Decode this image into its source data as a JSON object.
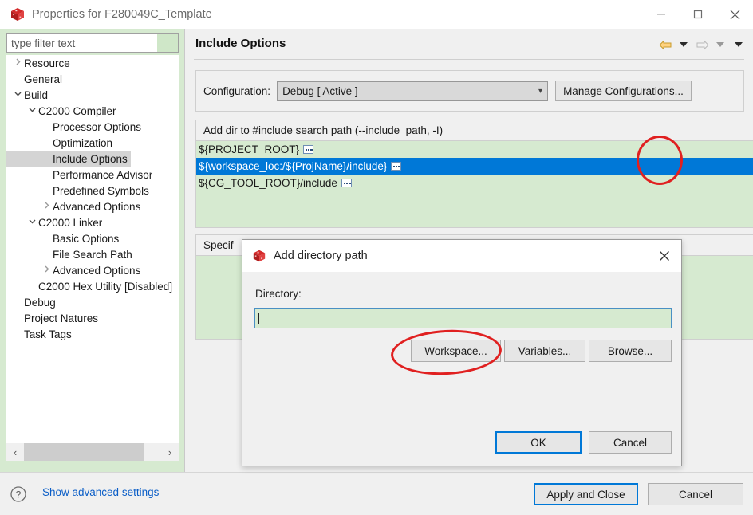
{
  "window": {
    "title": "Properties for F280049C_Template",
    "icon": "cube-icon",
    "minimize_label": "—",
    "maximize_label": "☐",
    "close_label": "✕"
  },
  "sidebar": {
    "filter": {
      "placeholder": "type filter text",
      "value": ""
    },
    "tree": [
      {
        "label": "Resource",
        "indent": 0,
        "twisty": "collapsed",
        "selected": false
      },
      {
        "label": "General",
        "indent": 0,
        "twisty": "none",
        "selected": false
      },
      {
        "label": "Build",
        "indent": 0,
        "twisty": "expanded",
        "selected": false
      },
      {
        "label": "C2000 Compiler",
        "indent": 1,
        "twisty": "expanded",
        "selected": false
      },
      {
        "label": "Processor Options",
        "indent": 2,
        "twisty": "none",
        "selected": false
      },
      {
        "label": "Optimization",
        "indent": 2,
        "twisty": "none",
        "selected": false
      },
      {
        "label": "Include Options",
        "indent": 2,
        "twisty": "none",
        "selected": true
      },
      {
        "label": "Performance Advisor",
        "indent": 2,
        "twisty": "none",
        "selected": false
      },
      {
        "label": "Predefined Symbols",
        "indent": 2,
        "twisty": "none",
        "selected": false
      },
      {
        "label": "Advanced Options",
        "indent": 2,
        "twisty": "collapsed",
        "selected": false
      },
      {
        "label": "C2000 Linker",
        "indent": 1,
        "twisty": "expanded",
        "selected": false
      },
      {
        "label": "Basic Options",
        "indent": 2,
        "twisty": "none",
        "selected": false
      },
      {
        "label": "File Search Path",
        "indent": 2,
        "twisty": "none",
        "selected": false
      },
      {
        "label": "Advanced Options",
        "indent": 2,
        "twisty": "collapsed",
        "selected": false
      },
      {
        "label": "C2000 Hex Utility  [Disabled]",
        "indent": 1,
        "twisty": "none",
        "selected": false
      },
      {
        "label": "Debug",
        "indent": 0,
        "twisty": "none",
        "selected": false
      },
      {
        "label": "Project Natures",
        "indent": 0,
        "twisty": "none",
        "selected": false
      },
      {
        "label": "Task Tags",
        "indent": 0,
        "twisty": "none",
        "selected": false
      }
    ],
    "hscroll": {
      "left_arrow": "‹",
      "right_arrow": "›"
    }
  },
  "page": {
    "title": "Include Options",
    "nav": {
      "back_icon": "arrow-left-icon",
      "back_dropdown_icon": "caret-down-icon",
      "forward_icon": "arrow-right-icon",
      "forward_dropdown_icon": "caret-down-icon",
      "menu_icon": "caret-down-icon"
    },
    "configuration": {
      "label": "Configuration:",
      "value": "Debug  [ Active ]",
      "chevron_icon": "chevron-down-icon",
      "manage_button": "Manage Configurations..."
    },
    "include_section": {
      "header": "Add dir to #include search path (--include_path, -I)",
      "tools": [
        {
          "name": "add-icon",
          "enabled": true
        },
        {
          "name": "delete-icon",
          "enabled": true
        },
        {
          "name": "edit-icon",
          "enabled": true
        },
        {
          "name": "move-up-icon",
          "enabled": true
        },
        {
          "name": "move-down-icon",
          "enabled": true
        }
      ],
      "rows": [
        {
          "text": "${PROJECT_ROOT}",
          "variable_glyph": true,
          "selected": false
        },
        {
          "text": "${workspace_loc:/${ProjName}/include}",
          "variable_glyph": true,
          "selected": true
        },
        {
          "text": "${CG_TOOL_ROOT}/include",
          "variable_glyph": true,
          "selected": false
        }
      ]
    },
    "specify_section": {
      "header": "Specif",
      "tools": [
        {
          "name": "delete-icon",
          "enabled": false
        },
        {
          "name": "edit-icon",
          "enabled": false
        },
        {
          "name": "move-up-icon",
          "enabled": false
        },
        {
          "name": "move-down-icon",
          "enabled": false
        }
      ]
    }
  },
  "footer": {
    "help_icon": "question-mark-icon",
    "advanced_link": "Show advanced settings",
    "apply_button": "Apply and Close",
    "cancel_button": "Cancel"
  },
  "dialog": {
    "icon": "cube-icon",
    "title": "Add directory path",
    "close_label": "✕",
    "directory_label": "Directory:",
    "directory_value": "",
    "buttons": {
      "workspace": "Workspace...",
      "variables": "Variables...",
      "browse": "Browse...",
      "ok": "OK",
      "cancel": "Cancel"
    }
  },
  "annotations": [
    {
      "name": "annotation-circle-add-button",
      "color": "#e02020"
    },
    {
      "name": "annotation-circle-workspace-button",
      "color": "#e02020"
    }
  ]
}
